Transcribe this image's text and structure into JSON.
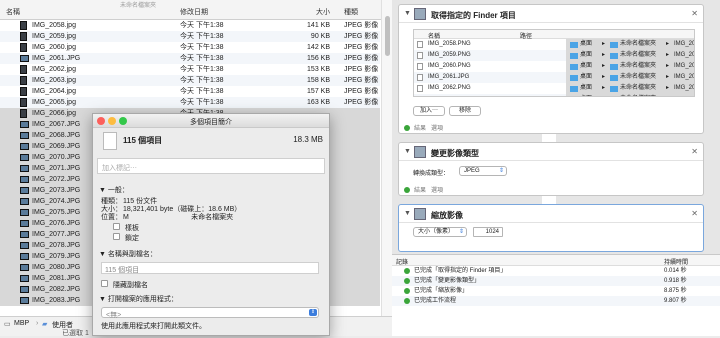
{
  "finder": {
    "top_title": "未命名檔案夾",
    "col_name": "名稱",
    "col_date": "修改日期",
    "col_size": "大小",
    "col_kind": "種類",
    "rows": [
      {
        "name": "IMG_2058.jpg",
        "date": "今天 下午1:38",
        "size": "141 KB",
        "kind": "JPEG 影像"
      },
      {
        "name": "IMG_2059.jpg",
        "date": "今天 下午1:38",
        "size": "90 KB",
        "kind": "JPEG 影像"
      },
      {
        "name": "IMG_2060.jpg",
        "date": "今天 下午1:38",
        "size": "142 KB",
        "kind": "JPEG 影像"
      },
      {
        "name": "IMG_2061.JPG",
        "date": "今天 下午1:38",
        "size": "156 KB",
        "kind": "JPEG 影像"
      },
      {
        "name": "IMG_2062.jpg",
        "date": "今天 下午1:38",
        "size": "153 KB",
        "kind": "JPEG 影像"
      },
      {
        "name": "IMG_2063.jpg",
        "date": "今天 下午1:38",
        "size": "158 KB",
        "kind": "JPEG 影像"
      },
      {
        "name": "IMG_2064.jpg",
        "date": "今天 下午1:38",
        "size": "157 KB",
        "kind": "JPEG 影像"
      },
      {
        "name": "IMG_2065.jpg",
        "date": "今天 下午1:38",
        "size": "163 KB",
        "kind": "JPEG 影像"
      },
      {
        "name": "IMG_2066.jpg",
        "date": "今天 下午1:38",
        "size": "",
        "kind": ""
      },
      {
        "name": "IMG_2067.JPG",
        "date": "",
        "size": "",
        "kind": ""
      },
      {
        "name": "IMG_2068.JPG",
        "date": "",
        "size": "",
        "kind": ""
      },
      {
        "name": "IMG_2069.JPG",
        "date": "",
        "size": "",
        "kind": ""
      },
      {
        "name": "IMG_2070.JPG",
        "date": "",
        "size": "",
        "kind": ""
      },
      {
        "name": "IMG_2071.JPG",
        "date": "",
        "size": "",
        "kind": ""
      },
      {
        "name": "IMG_2072.JPG",
        "date": "",
        "size": "",
        "kind": ""
      },
      {
        "name": "IMG_2073.JPG",
        "date": "",
        "size": "",
        "kind": ""
      },
      {
        "name": "IMG_2074.JPG",
        "date": "",
        "size": "",
        "kind": ""
      },
      {
        "name": "IMG_2075.JPG",
        "date": "",
        "size": "",
        "kind": ""
      },
      {
        "name": "IMG_2076.JPG",
        "date": "",
        "size": "",
        "kind": ""
      },
      {
        "name": "IMG_2077.JPG",
        "date": "",
        "size": "",
        "kind": ""
      },
      {
        "name": "IMG_2078.JPG",
        "date": "",
        "size": "",
        "kind": ""
      },
      {
        "name": "IMG_2079.JPG",
        "date": "",
        "size": "",
        "kind": ""
      },
      {
        "name": "IMG_2080.JPG",
        "date": "",
        "size": "",
        "kind": ""
      },
      {
        "name": "IMG_2081.JPG",
        "date": "",
        "size": "",
        "kind": ""
      },
      {
        "name": "IMG_2082.JPG",
        "date": "",
        "size": "",
        "kind": ""
      },
      {
        "name": "IMG_2083.JPG",
        "date": "",
        "size": "",
        "kind": ""
      }
    ],
    "path": [
      "MBP",
      "使用者"
    ],
    "status": "已選取 1"
  },
  "info": {
    "title": "多個項目簡介",
    "count": "115 個項目",
    "total_size": "18.3 MB",
    "tag_placeholder": "加入標記⋯",
    "general_label": "一般：",
    "kind_label": "種類：",
    "kind_value": "115 份文件",
    "size_label": "大小：",
    "size_value": "18,321,401 byte（磁碟上：18.6 MB）",
    "where_label": "位置：",
    "where_value": "M                                未命名檔案夾",
    "stationery": "樣板",
    "locked": "鎖定",
    "name_ext_label": "名稱與副檔名：",
    "name_field": "115 個項目",
    "hide_ext": "隱藏副檔名",
    "open_with_label": "打開檔案的應用程式：",
    "open_with_value": "<無>",
    "open_with_note": "使用此應用程式來打開此類文件。"
  },
  "automator": {
    "card1": {
      "title": "取得指定的 Finder 項目",
      "col_name": "名稱",
      "col_path": "路徑",
      "files": [
        "IMG_2058.PNG",
        "IMG_2059.PNG",
        "IMG_2060.PNG",
        "IMG_2061.JPG",
        "IMG_2062.PNG",
        "IMG_2063.PNG"
      ],
      "path_parts": [
        "桌面",
        "未命名檔案夾"
      ],
      "path_tail": [
        "IMG_2058",
        "IMG_205",
        "IMG_206",
        "IMG_206",
        "IMG_206",
        "IMG_206"
      ],
      "add": "加入⋯",
      "remove": "移除",
      "results": "結果",
      "options": "選項"
    },
    "card2": {
      "title": "變更影像類型",
      "label": "轉換成類型：",
      "value": "JPEG",
      "results": "結果",
      "options": "選項"
    },
    "card3": {
      "title": "縮放影像",
      "mode": "大小（像素）",
      "value": "1024",
      "results": "結果",
      "options": "選項"
    },
    "log": {
      "col_log": "記錄",
      "col_duration": "持續時間",
      "rows": [
        {
          "msg": "已完成「取得指定的 Finder 項目」",
          "dur": "0.014 秒"
        },
        {
          "msg": "已完成「變更影像類型」",
          "dur": "0.918 秒"
        },
        {
          "msg": "已完成「縮放影像」",
          "dur": "8.875 秒"
        },
        {
          "msg": "已完成工作流程",
          "dur": "9.807 秒"
        }
      ]
    }
  }
}
